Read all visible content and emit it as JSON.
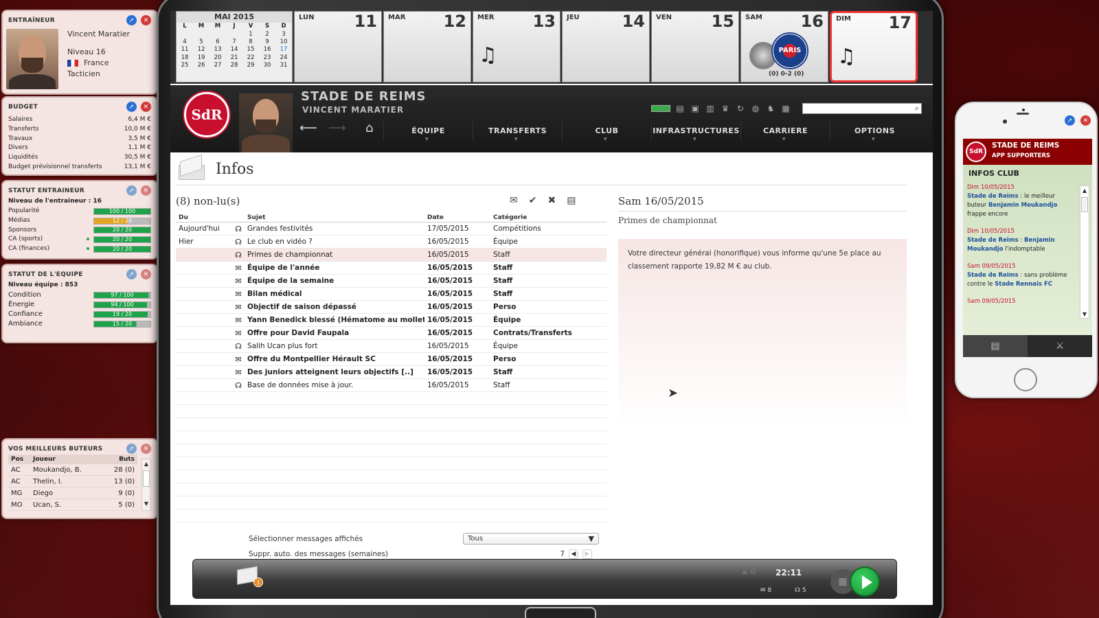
{
  "coach": {
    "title": "ENTRAÎNEUR",
    "name": "Vincent Maratier",
    "level": "Niveau 16",
    "country": "France",
    "style": "Tacticien"
  },
  "budget": {
    "title": "BUDGET",
    "rows": [
      {
        "label": "Salaires",
        "value": "6,4 M €"
      },
      {
        "label": "Transferts",
        "value": "10,0 M €"
      },
      {
        "label": "Travaux",
        "value": "3,5 M €"
      },
      {
        "label": "Divers",
        "value": "1,1 M €"
      },
      {
        "label": "Liquidités",
        "value": "30,5 M €"
      },
      {
        "label": "Budget prévisionnel transferts",
        "value": "13,1 M €"
      }
    ]
  },
  "statut_entraineur": {
    "title": "STATUT ENTRAINEUR",
    "subtitle": "Niveau de l'entraineur : 16",
    "rows": [
      {
        "label": "Popularité",
        "value": "100 / 100",
        "fill": 1.0,
        "color": "#1ea34a"
      },
      {
        "label": "Médias",
        "value": "12 / 20",
        "fill": 0.6,
        "color": "#e3a424"
      },
      {
        "label": "Sponsors",
        "value": "20 / 20",
        "fill": 1.0,
        "color": "#1ea34a"
      },
      {
        "label": "CA (sports)",
        "value": "20 / 20",
        "fill": 1.0,
        "color": "#1ea34a"
      },
      {
        "label": "CA (finances)",
        "value": "20 / 20",
        "fill": 1.0,
        "color": "#1ea34a"
      }
    ]
  },
  "statut_equipe": {
    "title": "STATUT DE L'EQUIPE",
    "subtitle": "Niveau équipe : 853",
    "rows": [
      {
        "label": "Condition",
        "value": "97 / 100",
        "fill": 0.97
      },
      {
        "label": "Énergie",
        "value": "94 / 100",
        "fill": 0.94
      },
      {
        "label": "Confiance",
        "value": "19 / 20",
        "fill": 0.95
      },
      {
        "label": "Ambiance",
        "value": "15 / 20",
        "fill": 0.75
      }
    ]
  },
  "buteurs": {
    "title": "VOS MEILLEURS BUTEURS",
    "headers": {
      "pos": "Pos",
      "player": "Joueur",
      "goals": "Buts"
    },
    "rows": [
      {
        "pos": "AC",
        "player": "Moukandjo, B.",
        "goals": "28 (0)"
      },
      {
        "pos": "AC",
        "player": "Thelin, I.",
        "goals": "13 (0)"
      },
      {
        "pos": "MG",
        "player": "Diego",
        "goals": "9 (0)"
      },
      {
        "pos": "MO",
        "player": "Ucan, S.",
        "goals": "5 (0)"
      }
    ]
  },
  "calendar": {
    "month": "MAI 2015",
    "weekday_headers": [
      "L",
      "M",
      "M",
      "J",
      "V",
      "S",
      "D"
    ],
    "weeks": [
      [
        "",
        "",
        "",
        "",
        "1",
        "2",
        "3"
      ],
      [
        "4",
        "5",
        "6",
        "7",
        "8",
        "9",
        "10"
      ],
      [
        "11",
        "12",
        "13",
        "14",
        "15",
        "16",
        "17"
      ],
      [
        "18",
        "19",
        "20",
        "21",
        "22",
        "23",
        "24"
      ],
      [
        "25",
        "26",
        "27",
        "28",
        "29",
        "30",
        "31"
      ]
    ],
    "days": [
      {
        "name": "LUN",
        "num": "11"
      },
      {
        "name": "MAR",
        "num": "12"
      },
      {
        "name": "MER",
        "num": "13"
      },
      {
        "name": "JEU",
        "num": "14"
      },
      {
        "name": "VEN",
        "num": "15"
      },
      {
        "name": "SAM",
        "num": "16",
        "score": "(0) 0-2 (0)",
        "opponent": "PARIS"
      },
      {
        "name": "DIM",
        "num": "17"
      }
    ]
  },
  "header": {
    "club_name": "STADE DE REIMS",
    "coach_name": "VINCENT MARATIER",
    "logo_text": "SdR",
    "menu": [
      "ÉQUIPE",
      "TRANSFERTS",
      "CLUB",
      "INFRASTRUCTURES",
      "CARRIERE",
      "OPTIONS"
    ]
  },
  "infos": {
    "title": "Infos",
    "unread": "(8) non-lu(s)",
    "columns": {
      "from": "Du",
      "subject": "Sujet",
      "date": "Date",
      "category": "Catégorie"
    },
    "messages": [
      {
        "from": "Aujourd'hui",
        "subject": "Grandes festivités",
        "date": "17/05/2015",
        "category": "Compétitions",
        "bold": false,
        "icon": "headset"
      },
      {
        "from": "Hier",
        "subject": "Le club en vidéo ?",
        "date": "16/05/2015",
        "category": "Équipe",
        "bold": false,
        "icon": "headset"
      },
      {
        "from": "",
        "subject": "Primes de championnat",
        "date": "16/05/2015",
        "category": "Staff",
        "bold": false,
        "icon": "headset",
        "highlight": true
      },
      {
        "from": "",
        "subject": "Équipe de l'année",
        "date": "16/05/2015",
        "category": "Staff",
        "bold": true,
        "icon": "envelope"
      },
      {
        "from": "",
        "subject": "Équipe de la semaine",
        "date": "16/05/2015",
        "category": "Staff",
        "bold": true,
        "icon": "envelope"
      },
      {
        "from": "",
        "subject": "Bilan médical",
        "date": "16/05/2015",
        "category": "Staff",
        "bold": true,
        "icon": "envelope"
      },
      {
        "from": "",
        "subject": "Objectif de saison dépassé",
        "date": "16/05/2015",
        "category": "Perso",
        "bold": true,
        "icon": "envelope"
      },
      {
        "from": "",
        "subject": "Yann Benedick blessé (Hématome au mollet)",
        "date": "16/05/2015",
        "category": "Équipe",
        "bold": true,
        "icon": "envelope"
      },
      {
        "from": "",
        "subject": "Offre pour David Faupala",
        "date": "16/05/2015",
        "category": "Contrats/Transferts",
        "bold": true,
        "icon": "envelope"
      },
      {
        "from": "",
        "subject": "Salih Ucan plus fort",
        "date": "16/05/2015",
        "category": "Équipe",
        "bold": false,
        "icon": "headset"
      },
      {
        "from": "",
        "subject": "Offre du Montpellier Hérault SC",
        "date": "16/05/2015",
        "category": "Perso",
        "bold": true,
        "icon": "envelope"
      },
      {
        "from": "",
        "subject": "Des juniors atteignent leurs objectifs [..]",
        "date": "16/05/2015",
        "category": "Staff",
        "bold": true,
        "icon": "envelope"
      },
      {
        "from": "",
        "subject": "Base de données mise à jour.",
        "date": "16/05/2015",
        "category": "Staff",
        "bold": false,
        "icon": "headset"
      }
    ],
    "filter_label": "Sélectionner messages affichés",
    "filter_value": "Tous",
    "autodelete_label": "Suppr. auto. des messages (semaines)",
    "autodelete_value": "7",
    "detail": {
      "date": "Sam 16/05/2015",
      "subject": "Primes de championnat",
      "body": "Votre directeur général (honorifique) vous informe qu'une 5e place au classement rapporte 19,82 M € au club."
    }
  },
  "bottom": {
    "badge": "1",
    "time": "22:11",
    "mail_count": "8",
    "chat_count": "5"
  },
  "phone": {
    "title": "STADE DE REIMS",
    "subtitle": "APP SUPPORTERS",
    "section": "INFOS CLUB",
    "news": [
      {
        "date": "Dim 10/05/2015",
        "club": "Stade de Reims",
        "pre": " : le meilleur buteur ",
        "hl": "Benjamin Moukandjo",
        "post": " frappe encore"
      },
      {
        "date": "Dim 10/05/2015",
        "club": "Stade de Reims",
        "pre": " : ",
        "hl": "Benjamin Moukandjo",
        "post": " l'indomptable"
      },
      {
        "date": "Sam 09/05/2015",
        "club": "Stade de Reims",
        "pre": " : sans problème contre le ",
        "hl": "Stade Rennais FC",
        "post": ""
      },
      {
        "date": "Sam 09/05/2015",
        "club": "",
        "pre": "",
        "hl": "",
        "post": ""
      }
    ]
  }
}
